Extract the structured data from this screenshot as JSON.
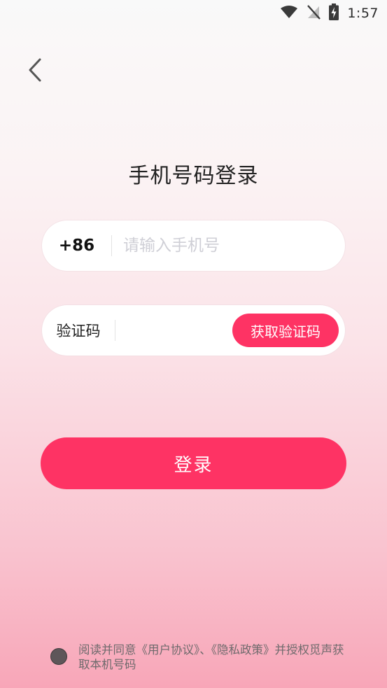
{
  "status_bar": {
    "time": "1:57",
    "icons": [
      "wifi-icon",
      "no-signal-icon",
      "battery-charging-icon"
    ]
  },
  "nav": {
    "back_icon": "chevron-left-icon"
  },
  "title": "手机号码登录",
  "phone_field": {
    "country_code": "+86",
    "placeholder": "请输入手机号",
    "value": ""
  },
  "code_field": {
    "label": "验证码",
    "value": "",
    "get_code_label": "获取验证码"
  },
  "login_button": {
    "label": "登录"
  },
  "agreement": {
    "checked": false,
    "prefix": "阅读并同意",
    "user_agreement": "《用户协议》",
    "separator": "、",
    "privacy_policy": "《隐私政策》",
    "suffix": "并授权觅声获取本机号码"
  },
  "colors": {
    "accent": "#fe3364",
    "title_text": "#222222",
    "placeholder": "#cfcfd6",
    "agreement_text": "#6e6a6c"
  }
}
